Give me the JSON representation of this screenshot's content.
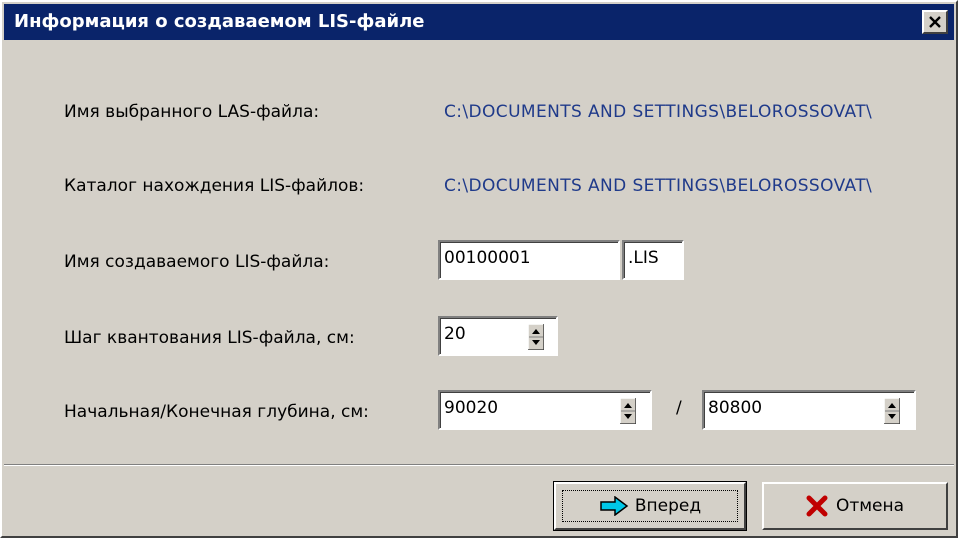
{
  "dialog": {
    "title": "Информация о создаваемом LIS-файле",
    "close_glyph": "✕"
  },
  "fields": {
    "las_file_label": "Имя выбранного LAS-файла:",
    "las_file_value": "C:\\DOCUMENTS AND SETTINGS\\BELOROSSOVAT\\",
    "lis_dir_label": "Каталог нахождения LIS-файлов:",
    "lis_dir_value": "C:\\DOCUMENTS AND SETTINGS\\BELOROSSOVAT\\",
    "lis_name_label": "Имя создаваемого LIS-файла:",
    "lis_name_value": "00100001",
    "lis_ext_value": ".LIS",
    "step_label": "Шаг квантования LIS-файла, см:",
    "step_value": "20",
    "depth_label": "Начальная/Конечная глубина, см:",
    "depth_start_value": "90020",
    "depth_separator": "/",
    "depth_end_value": "80800"
  },
  "buttons": {
    "next_label": "Вперед",
    "cancel_label": "Отмена"
  },
  "colors": {
    "title_bg": "#0a246a",
    "path_text": "#1f3a8a",
    "arrow_fill": "#00c8e8",
    "cancel_x": "#c00000"
  },
  "icons": {
    "next": "right-arrow-icon",
    "cancel": "red-x-icon"
  }
}
